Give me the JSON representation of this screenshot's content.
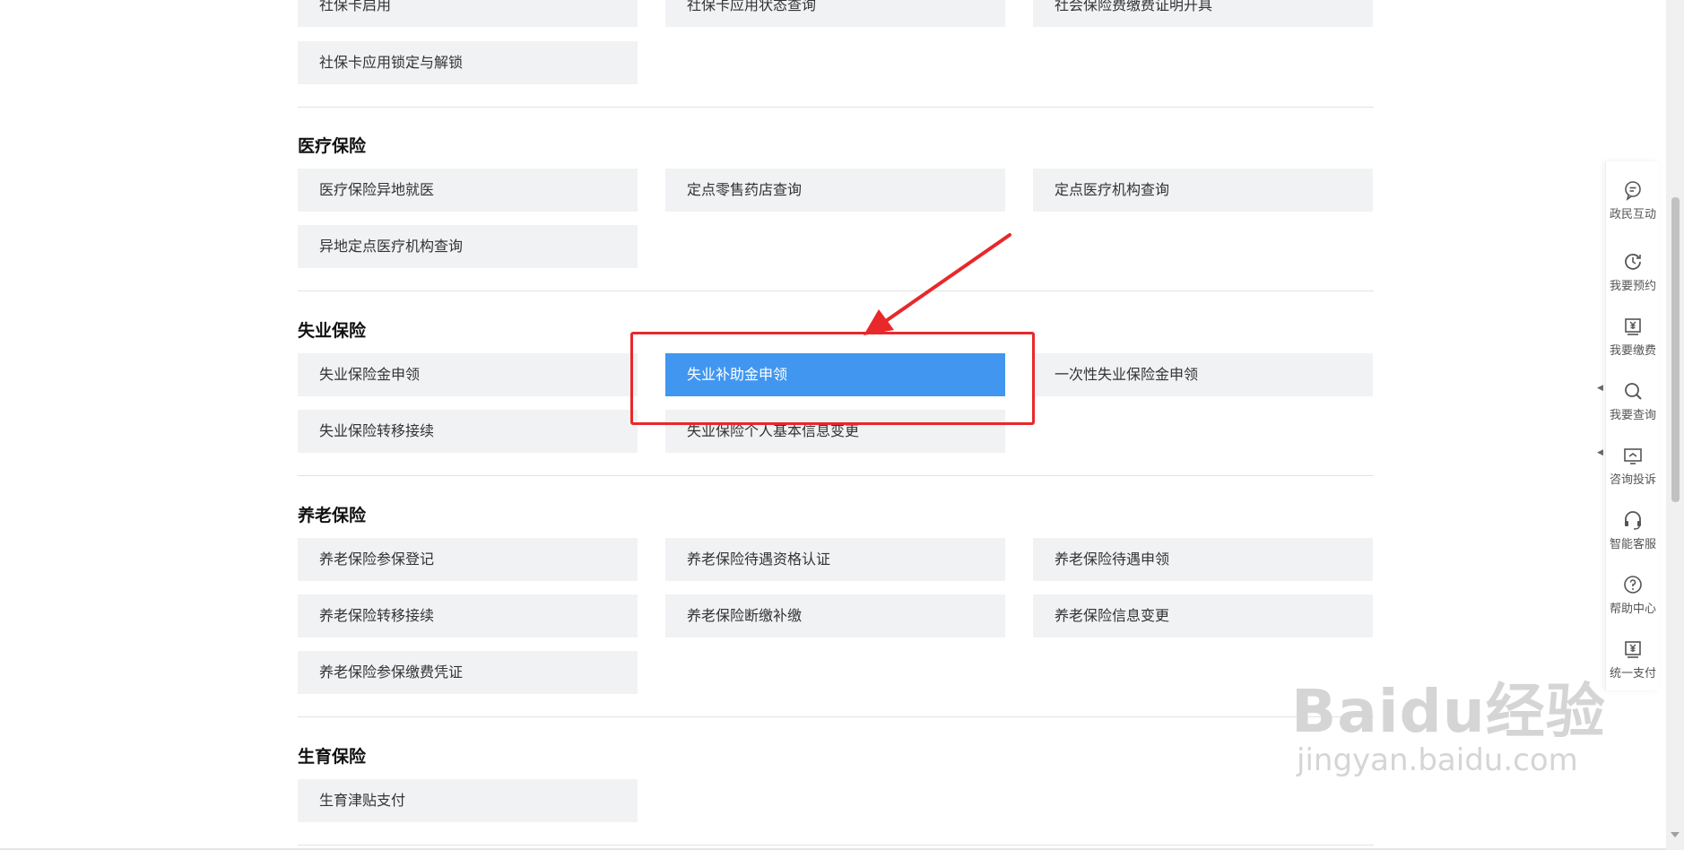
{
  "top_section": {
    "items": [
      "社保卡启用",
      "社保卡应用状态查询",
      "社会保险费缴费证明开具",
      "社保卡应用锁定与解锁"
    ]
  },
  "medical": {
    "title": "医疗保险",
    "items": [
      "医疗保险异地就医",
      "定点零售药店查询",
      "定点医疗机构查询",
      "异地定点医疗机构查询"
    ]
  },
  "unemployment": {
    "title": "失业保险",
    "items": [
      "失业保险金申领",
      "失业补助金申领",
      "一次性失业保险金申领",
      "失业保险转移接续",
      "失业保险个人基本信息变更"
    ],
    "highlighted": "失业补助金申领"
  },
  "pension": {
    "title": "养老保险",
    "items": [
      "养老保险参保登记",
      "养老保险待遇资格认证",
      "养老保险待遇申领",
      "养老保险转移接续",
      "养老保险断缴补缴",
      "养老保险信息变更",
      "养老保险参保缴费凭证"
    ]
  },
  "maternity": {
    "title": "生育保险",
    "items": [
      "生育津贴支付"
    ]
  },
  "sidebar": {
    "items": [
      {
        "label": "政民互动",
        "icon": "chat-icon"
      },
      {
        "label": "我要预约",
        "icon": "clock-icon"
      },
      {
        "label": "我要缴费",
        "icon": "payment-icon"
      },
      {
        "label": "我要查询",
        "icon": "search-icon"
      },
      {
        "label": "咨询投诉",
        "icon": "monitor-icon"
      },
      {
        "label": "智能客服",
        "icon": "headset-icon"
      },
      {
        "label": "帮助中心",
        "icon": "help-icon"
      },
      {
        "label": "统一支付",
        "icon": "payment-icon"
      }
    ]
  },
  "watermark": {
    "brand": "Baidu经验",
    "url": "jingyan.baidu.com"
  },
  "colors": {
    "active": "#4196f0",
    "annotation": "#e8282b",
    "item_bg": "#f1f2f4"
  }
}
